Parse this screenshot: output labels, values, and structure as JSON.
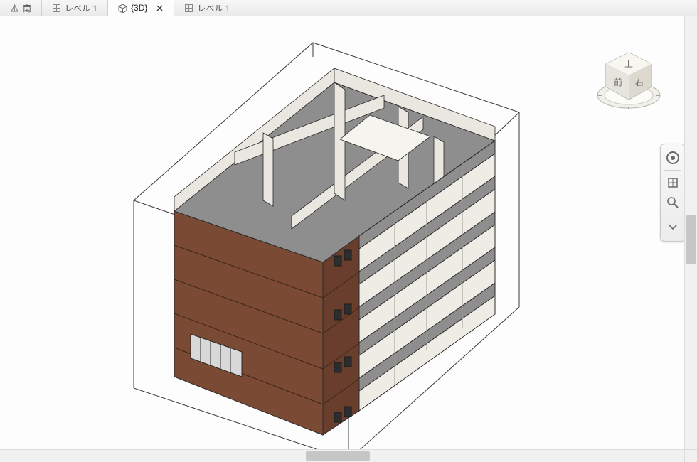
{
  "tabs": [
    {
      "label": "南",
      "icon": "elevation"
    },
    {
      "label": "レベル 1",
      "icon": "plan"
    },
    {
      "label": "{3D}",
      "icon": "3d",
      "active": true,
      "closable": true
    },
    {
      "label": "レベル 1",
      "icon": "plan"
    }
  ],
  "viewcube": {
    "top": "上",
    "front": "前",
    "right": "右"
  },
  "navbar": {
    "tools": [
      "steering-wheel",
      "home",
      "camera",
      "pan",
      "zoom",
      "orbit"
    ]
  },
  "colors": {
    "wall_brick": "#7a4a34",
    "wall_brick_shade": "#6a3e2c",
    "floor": "#8e8e8e",
    "floor_light": "#cfcfcf",
    "interior": "#e9e7e0",
    "line": "#2a2a2a"
  },
  "model": {
    "view": "3D isometric section box",
    "storeys": 5,
    "description": "Multi-storey building cut by a section box; left face solid brick, right side cut showing floor slabs and interior partitions on top level."
  }
}
